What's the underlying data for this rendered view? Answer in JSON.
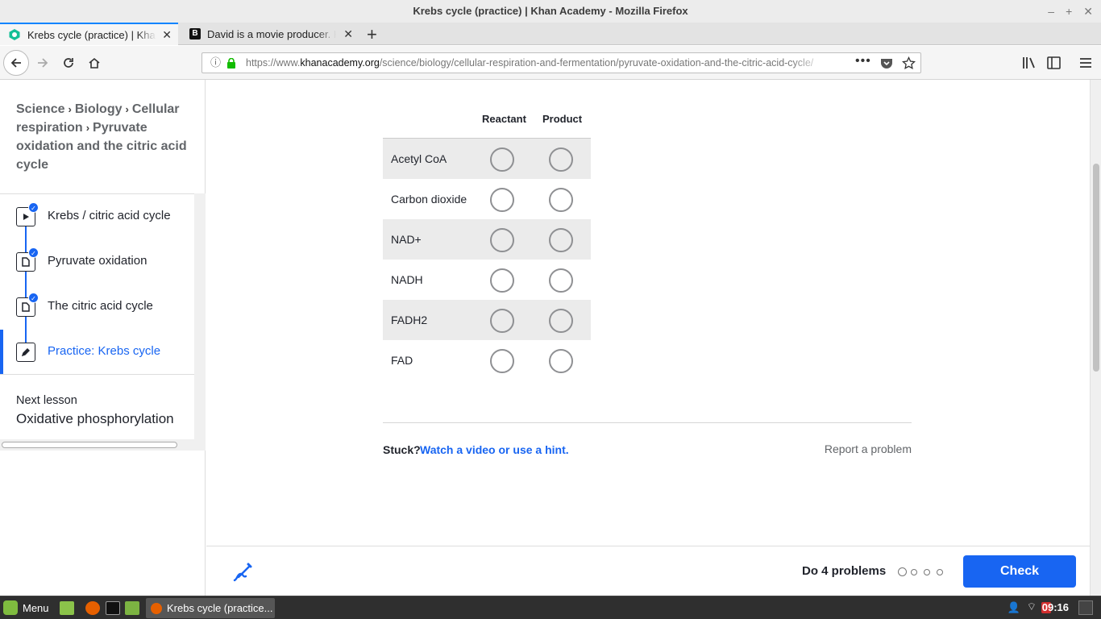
{
  "window": {
    "title": "Krebs cycle (practice) | Khan Academy - Mozilla Firefox"
  },
  "tabs": [
    {
      "title": "Krebs cycle (practice) | Khan Academy",
      "active": true
    },
    {
      "title": "David is a movie producer. He",
      "active": false
    }
  ],
  "nav": {
    "url_prefix": "https://www.",
    "url_domain": "khanacademy.org",
    "url_path": "/science/biology/cellular-respiration-and-fermentation/pyruvate-oxidation-and-the-citric-acid-cycle/"
  },
  "sidebar": {
    "breadcrumbs": [
      "Science",
      "Biology",
      "Cellular respiration",
      "Pyruvate oxidation and the citric acid cycle"
    ],
    "lessons": [
      {
        "label": "Krebs / citric acid cycle",
        "type": "video",
        "completed": true
      },
      {
        "label": "Pyruvate oxidation",
        "type": "article",
        "completed": true
      },
      {
        "label": "The citric acid cycle",
        "type": "article",
        "completed": true
      },
      {
        "label": "Practice: Krebs cycle",
        "type": "exercise",
        "completed": false,
        "active": true
      }
    ],
    "next_label": "Next lesson",
    "next_title": "Oxidative phosphorylation"
  },
  "exercise": {
    "columns": [
      "Reactant",
      "Product"
    ],
    "rows": [
      "Acetyl CoA",
      "Carbon dioxide",
      "NAD+",
      "NADH",
      "FADH2",
      "FAD"
    ],
    "stuck_label": "Stuck?",
    "hint_link": "Watch a video or use a hint.",
    "report_link": "Report a problem"
  },
  "footer": {
    "do_problems": "Do 4 problems",
    "check_label": "Check"
  },
  "taskbar": {
    "menu_label": "Menu",
    "window_label": "Krebs cycle (practice...",
    "clock": "09:16"
  },
  "colors": {
    "accent": "#1865f2",
    "checkmark": "#1865f2"
  }
}
